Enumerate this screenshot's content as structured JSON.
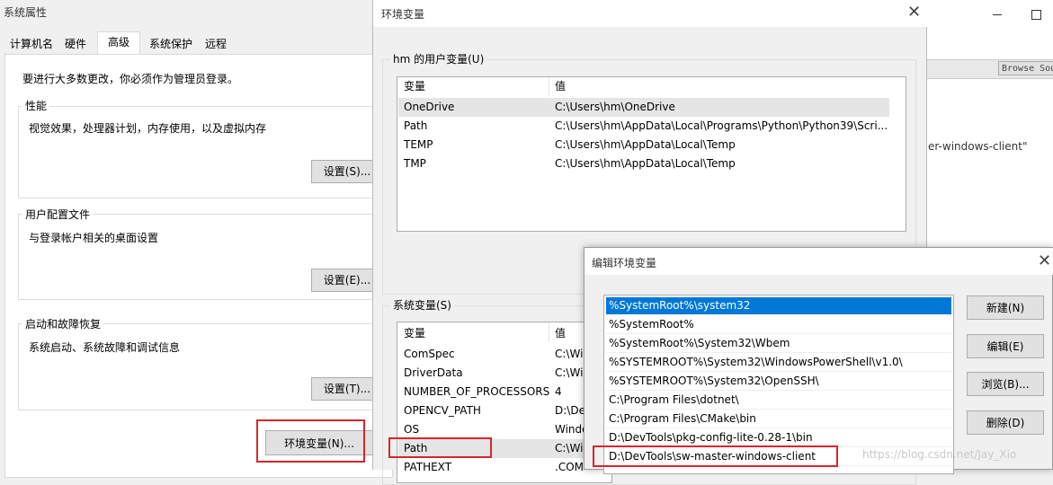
{
  "sysprops": {
    "title": "系统属性",
    "tabs": [
      "计算机名",
      "硬件",
      "高级",
      "系统保护",
      "远程"
    ],
    "notice": "要进行大多数更改，你必须作为管理员登录。",
    "perf_label": "性能",
    "perf_desc": "视觉效果，处理器计划，内存使用，以及虚拟内存",
    "perf_btn": "设置(S)...",
    "profile_label": "用户配置文件",
    "profile_desc": "与登录帐户相关的桌面设置",
    "profile_btn": "设置(E)...",
    "startup_label": "启动和故障恢复",
    "startup_desc": "系统启动、系统故障和调试信息",
    "startup_btn": "设置(T)...",
    "envvar_btn": "环境变量(N)..."
  },
  "envvars": {
    "title": "环境变量",
    "user_label": "hm 的用户变量(U)",
    "col_var": "变量",
    "col_val": "值",
    "user_rows": [
      {
        "name": "OneDrive",
        "value": "C:\\Users\\hm\\OneDrive"
      },
      {
        "name": "Path",
        "value": "C:\\Users\\hm\\AppData\\Local\\Programs\\Python\\Python39\\Scri..."
      },
      {
        "name": "TEMP",
        "value": "C:\\Users\\hm\\AppData\\Local\\Temp"
      },
      {
        "name": "TMP",
        "value": "C:\\Users\\hm\\AppData\\Local\\Temp"
      }
    ],
    "sys_label": "系统变量(S)",
    "sys_rows": [
      {
        "name": "ComSpec",
        "value": "C:\\Wir"
      },
      {
        "name": "DriverData",
        "value": "C:\\Wir"
      },
      {
        "name": "NUMBER_OF_PROCESSORS",
        "value": "4"
      },
      {
        "name": "OPENCV_PATH",
        "value": "D:\\Dev"
      },
      {
        "name": "OS",
        "value": "Windo"
      },
      {
        "name": "Path",
        "value": "C:\\Wir"
      },
      {
        "name": "PATHEXT",
        "value": ".COM"
      }
    ]
  },
  "background": {
    "browse_btn": "Browse Sou",
    "text": "er-windows-client\""
  },
  "editdlg": {
    "title": "编辑环境变量",
    "entries": [
      "%SystemRoot%\\system32",
      "%SystemRoot%",
      "%SystemRoot%\\System32\\Wbem",
      "%SYSTEMROOT%\\System32\\WindowsPowerShell\\v1.0\\",
      "%SYSTEMROOT%\\System32\\OpenSSH\\",
      "C:\\Program Files\\dotnet\\",
      "C:\\Program Files\\CMake\\bin",
      "D:\\DevTools\\pkg-config-lite-0.28-1\\bin",
      "D:\\DevTools\\sw-master-windows-client"
    ],
    "btn_new": "新建(N)",
    "btn_edit": "编辑(E)",
    "btn_browse": "浏览(B)...",
    "btn_delete": "删除(D)",
    "watermark": "https://blog.csdn.net/Jay_Xio"
  },
  "colors": {
    "selection": "#0078d7",
    "highlight": "#d6262e",
    "dialog_bg": "#f0f0f0"
  }
}
